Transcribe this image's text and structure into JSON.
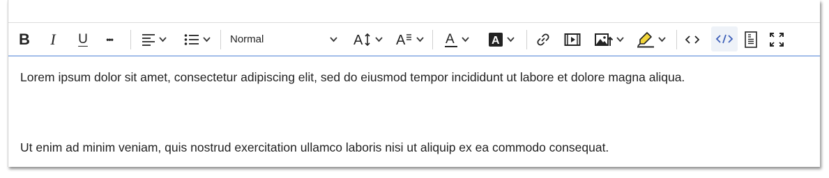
{
  "toolbar": {
    "bold_label": "B",
    "italic_label": "I",
    "underline_label": "U",
    "more_label": "•••",
    "paragraph_format": "Normal",
    "icons": [
      "bold-icon",
      "italic-icon",
      "underline-icon",
      "more-icon",
      "align-left-icon",
      "list-icon",
      "font-size-icon",
      "text-style-icon",
      "font-color-icon",
      "background-color-icon",
      "link-icon",
      "video-icon",
      "image-icon",
      "highlight-icon",
      "inline-code-icon",
      "code-view-icon",
      "document-icon",
      "fullscreen-icon"
    ]
  },
  "content": {
    "paragraphs": [
      "Lorem ipsum dolor sit amet, consectetur adipiscing elit, sed do eiusmod tempor incididunt ut labore et dolore magna aliqua.",
      "Ut enim ad minim veniam, quis nostrud exercitation ullamco laboris nisi ut aliquip ex ea commodo consequat."
    ]
  },
  "colors": {
    "focus_border": "#4a7fd4",
    "highlight": "#f2d53a",
    "code_view_accent": "#3d5fb8"
  }
}
